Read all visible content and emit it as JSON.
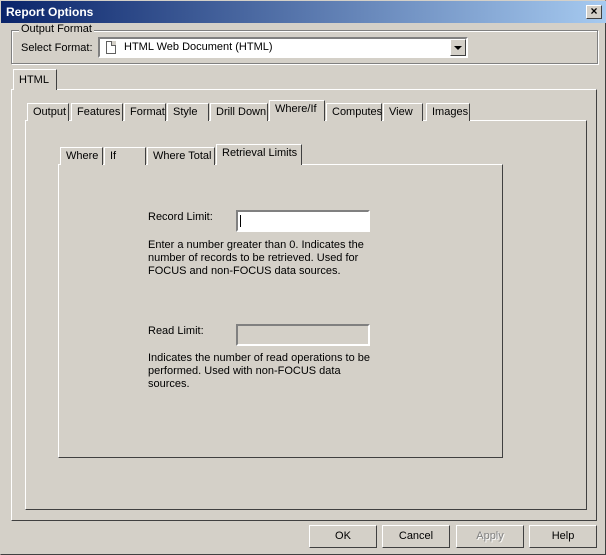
{
  "window": {
    "title": "Report Options"
  },
  "output_format": {
    "legend": "Output Format",
    "select_label": "Select Format:",
    "selected": "HTML Web Document (HTML)"
  },
  "format_tabs": [
    {
      "label": "HTML",
      "active": true
    }
  ],
  "option_tabs": [
    {
      "label": "Output"
    },
    {
      "label": "Features"
    },
    {
      "label": "Format"
    },
    {
      "label": "Style"
    },
    {
      "label": "Drill Down"
    },
    {
      "label": "Where/If",
      "active": true
    },
    {
      "label": "Computes"
    },
    {
      "label": "View"
    },
    {
      "label": "Images"
    }
  ],
  "sub_tabs": [
    {
      "label": "Where"
    },
    {
      "label": "If"
    },
    {
      "label": "Where Total"
    },
    {
      "label": "Retrieval Limits",
      "active": true
    }
  ],
  "retrieval": {
    "record_limit_label": "Record Limit:",
    "record_limit_value": "",
    "record_limit_help": "Enter a number greater than 0.  Indicates the number of records to be retrieved.  Used for FOCUS and non-FOCUS data sources.",
    "read_limit_label": "Read Limit:",
    "read_limit_value": "",
    "read_limit_help": "Indicates the number of read operations to be performed.  Used with non-FOCUS data sources."
  },
  "buttons": {
    "ok": "OK",
    "cancel": "Cancel",
    "apply": "Apply",
    "help": "Help"
  }
}
